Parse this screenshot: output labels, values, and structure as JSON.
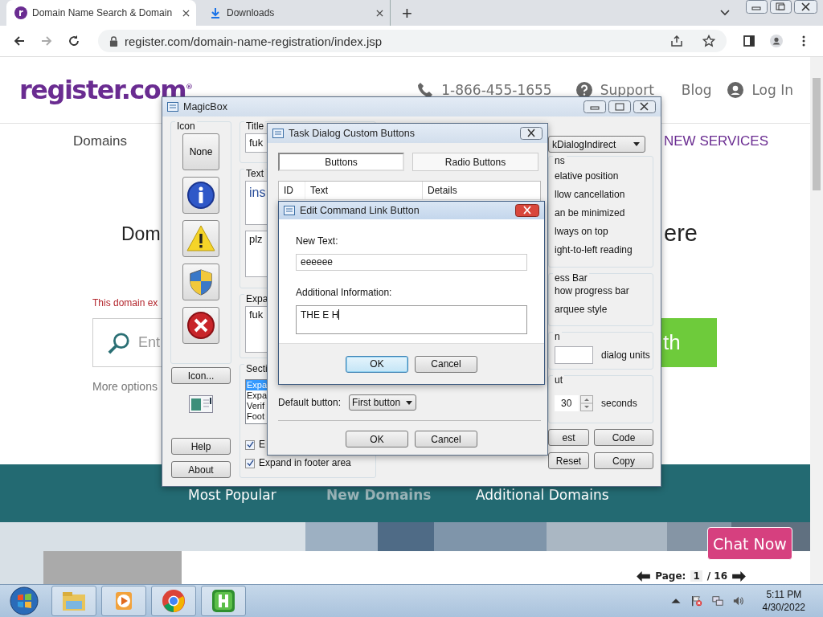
{
  "browser": {
    "tabs": [
      {
        "title": "Domain Name Search & Domain",
        "selected": true,
        "kind": "site"
      },
      {
        "title": "Downloads",
        "selected": false,
        "kind": "download"
      }
    ],
    "new_tab": "+",
    "address": "register.com/domain-name-registration/index.jsp"
  },
  "site": {
    "logo": "register.com",
    "logo_mark": "®",
    "phone": "1-866-455-1655",
    "support": "Support",
    "blog": "Blog",
    "login": "Log In",
    "nav": [
      "Domains"
    ],
    "nav_right": "NEW SERVICES",
    "headline_left": "Dom",
    "headline_right": "ere",
    "notice": "This domain ex",
    "search_placeholder": "Ent",
    "search_button": "th",
    "more_options": "More options",
    "band_tabs": [
      {
        "label": "Most Popular",
        "selected": false
      },
      {
        "label": "New Domains",
        "selected": true
      },
      {
        "label": "Additional Domains",
        "selected": false
      }
    ],
    "chat": "Chat Now",
    "pager": {
      "label": "Page:",
      "current": "1",
      "total": "/ 16"
    }
  },
  "magicbox": {
    "title": "MagicBox",
    "icon_group": "Icon",
    "icon_buttons": [
      {
        "kind": "none",
        "label": "None"
      },
      {
        "kind": "info"
      },
      {
        "kind": "warning"
      },
      {
        "kind": "shield"
      },
      {
        "kind": "error"
      }
    ],
    "icon_browse": "Icon...",
    "help": "Help",
    "about": "About",
    "title_group": "Title",
    "title_value": "fuk",
    "text_group": "Text",
    "main_text": "ins",
    "content_text": "plz",
    "expanded_group": "Expa",
    "expanded_text": "fuk",
    "sections_group": "Secti",
    "sections": [
      {
        "label": "Expa",
        "selected": true
      },
      {
        "label": "Expa",
        "selected": false
      },
      {
        "label": "Verif",
        "selected": false
      },
      {
        "label": "Foot",
        "selected": false
      }
    ],
    "checks": [
      {
        "label": "E",
        "checked": true
      },
      {
        "label": "Expand in footer area",
        "checked": true
      }
    ],
    "function_value": "kDialogIndirect",
    "options_group": "ns",
    "options": [
      "elative position",
      "llow cancellation",
      "an be minimized",
      "lways on top",
      "ight-to-left reading"
    ],
    "progress_group": "ess Bar",
    "progress_options": [
      "how progress bar",
      "arquee style"
    ],
    "width_group": "n",
    "width_unit": "dialog units",
    "timeout_group": "ut",
    "timeout_value": "30",
    "timeout_unit": "seconds",
    "buttons": [
      "est",
      "Code",
      "Reset",
      "Copy"
    ]
  },
  "task_dialog": {
    "title": "Task Dialog Custom Buttons",
    "tabs": [
      {
        "label": "Buttons",
        "selected": true
      },
      {
        "label": "Radio Buttons",
        "selected": false
      }
    ],
    "columns": [
      "ID",
      "Text",
      "Details"
    ],
    "default_label": "Default button:",
    "default_value": "First button",
    "buttons": [
      "OK",
      "Cancel"
    ]
  },
  "edit_dialog": {
    "title": "Edit Command Link Button",
    "new_text_label": "New Text:",
    "new_text": "eeeeee",
    "info_label": "Additional Information:",
    "info": "THE E H",
    "buttons": [
      {
        "label": "OK",
        "default": true
      },
      {
        "label": "Cancel",
        "default": false
      }
    ]
  },
  "taskbar": {
    "time": "5:11 PM",
    "date": "4/30/2022"
  }
}
